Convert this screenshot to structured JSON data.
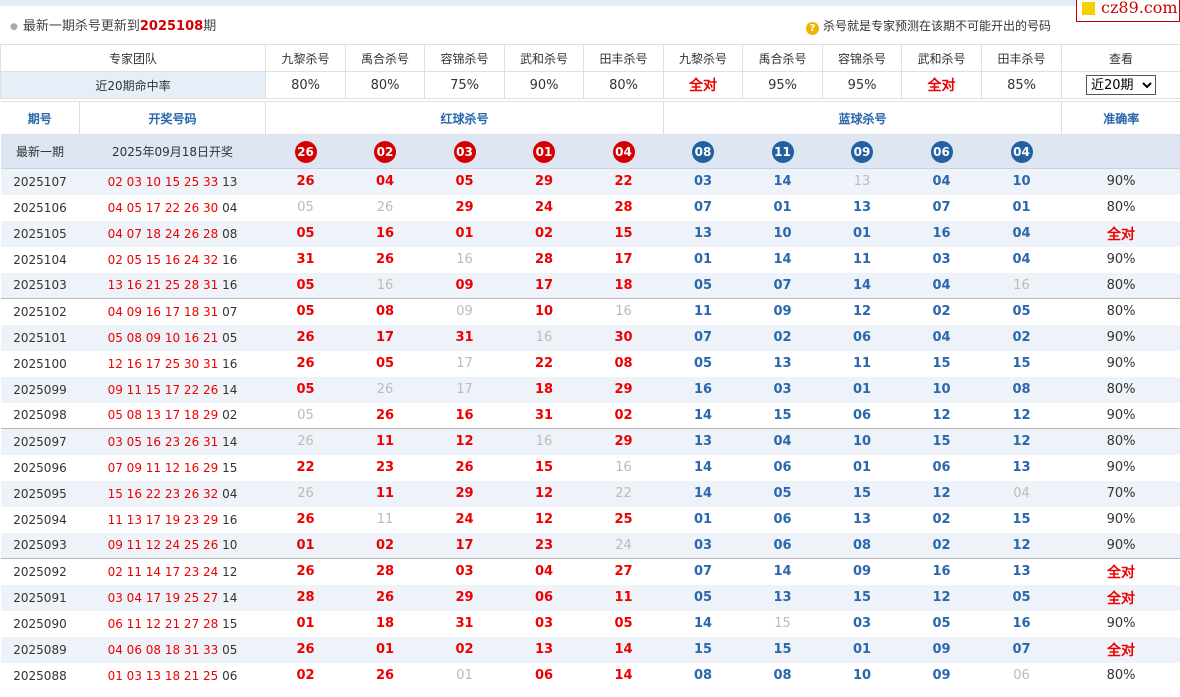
{
  "header": {
    "update_prefix": "最新一期杀号更新到",
    "latest_issue": "2025108",
    "update_suffix": "期",
    "tip_icon": "question-icon",
    "tip_text": "杀号就是专家预测在该期不可能开出的号码",
    "logo_text": "cz89.com"
  },
  "experts": {
    "team_label": "专家团队",
    "names": [
      "九黎杀号",
      "禹合杀号",
      "容锦杀号",
      "武和杀号",
      "田丰杀号",
      "九黎杀号",
      "禹合杀号",
      "容锦杀号",
      "武和杀号",
      "田丰杀号"
    ],
    "view_label": "查看",
    "rate_label": "近20期命中率",
    "rates": [
      "80%",
      "80%",
      "75%",
      "90%",
      "80%",
      "全对",
      "95%",
      "95%",
      "全对",
      "85%"
    ],
    "period_select": "近20期"
  },
  "columns": {
    "issue": "期号",
    "draw": "开奖号码",
    "red_kill": "红球杀号",
    "blue_kill": "蓝球杀号",
    "accuracy": "准确率"
  },
  "latest": {
    "label": "最新一期",
    "draw_date": "2025年09月18日开奖",
    "red": [
      "26",
      "02",
      "03",
      "01",
      "04"
    ],
    "blue": [
      "08",
      "11",
      "09",
      "06",
      "04"
    ]
  },
  "colors": {
    "red": "#d60000",
    "blue": "#23609f",
    "miss": "#bbbbbb",
    "header_blue": "#2a67ad"
  },
  "rows": [
    {
      "issue": "2025107",
      "red_nums": "02 03 10 15 25 33",
      "blue_num": "13",
      "red": [
        "26",
        "04",
        "05",
        "29",
        "22"
      ],
      "red_hit": [
        1,
        1,
        1,
        1,
        1
      ],
      "blue": [
        "03",
        "14",
        "13",
        "04",
        "10"
      ],
      "blue_hit": [
        1,
        1,
        0,
        1,
        1
      ],
      "acc": "90%"
    },
    {
      "issue": "2025106",
      "red_nums": "04 05 17 22 26 30",
      "blue_num": "04",
      "red": [
        "05",
        "26",
        "29",
        "24",
        "28"
      ],
      "red_hit": [
        0,
        0,
        1,
        1,
        1
      ],
      "blue": [
        "07",
        "01",
        "13",
        "07",
        "01"
      ],
      "blue_hit": [
        1,
        1,
        1,
        1,
        1
      ],
      "acc": "80%"
    },
    {
      "issue": "2025105",
      "red_nums": "04 07 18 24 26 28",
      "blue_num": "08",
      "red": [
        "05",
        "16",
        "01",
        "02",
        "15"
      ],
      "red_hit": [
        1,
        1,
        1,
        1,
        1
      ],
      "blue": [
        "13",
        "10",
        "01",
        "16",
        "04"
      ],
      "blue_hit": [
        1,
        1,
        1,
        1,
        1
      ],
      "acc": "全对"
    },
    {
      "issue": "2025104",
      "red_nums": "02 05 15 16 24 32",
      "blue_num": "16",
      "red": [
        "31",
        "26",
        "16",
        "28",
        "17"
      ],
      "red_hit": [
        1,
        1,
        0,
        1,
        1
      ],
      "blue": [
        "01",
        "14",
        "11",
        "03",
        "04"
      ],
      "blue_hit": [
        1,
        1,
        1,
        1,
        1
      ],
      "acc": "90%"
    },
    {
      "issue": "2025103",
      "red_nums": "13 16 21 25 28 31",
      "blue_num": "16",
      "red": [
        "05",
        "16",
        "09",
        "17",
        "18"
      ],
      "red_hit": [
        1,
        0,
        1,
        1,
        1
      ],
      "blue": [
        "05",
        "07",
        "14",
        "04",
        "16"
      ],
      "blue_hit": [
        1,
        1,
        1,
        1,
        0
      ],
      "acc": "80%"
    },
    {
      "issue": "2025102",
      "red_nums": "04 09 16 17 18 31",
      "blue_num": "07",
      "red": [
        "05",
        "08",
        "09",
        "10",
        "16"
      ],
      "red_hit": [
        1,
        1,
        0,
        1,
        0
      ],
      "blue": [
        "11",
        "09",
        "12",
        "02",
        "05"
      ],
      "blue_hit": [
        1,
        1,
        1,
        1,
        1
      ],
      "acc": "80%"
    },
    {
      "issue": "2025101",
      "red_nums": "05 08 09 10 16 21",
      "blue_num": "05",
      "red": [
        "26",
        "17",
        "31",
        "16",
        "30"
      ],
      "red_hit": [
        1,
        1,
        1,
        0,
        1
      ],
      "blue": [
        "07",
        "02",
        "06",
        "04",
        "02"
      ],
      "blue_hit": [
        1,
        1,
        1,
        1,
        1
      ],
      "acc": "90%"
    },
    {
      "issue": "2025100",
      "red_nums": "12 16 17 25 30 31",
      "blue_num": "16",
      "red": [
        "26",
        "05",
        "17",
        "22",
        "08"
      ],
      "red_hit": [
        1,
        1,
        0,
        1,
        1
      ],
      "blue": [
        "05",
        "13",
        "11",
        "15",
        "15"
      ],
      "blue_hit": [
        1,
        1,
        1,
        1,
        1
      ],
      "acc": "90%"
    },
    {
      "issue": "2025099",
      "red_nums": "09 11 15 17 22 26",
      "blue_num": "14",
      "red": [
        "05",
        "26",
        "17",
        "18",
        "29"
      ],
      "red_hit": [
        1,
        0,
        0,
        1,
        1
      ],
      "blue": [
        "16",
        "03",
        "01",
        "10",
        "08"
      ],
      "blue_hit": [
        1,
        1,
        1,
        1,
        1
      ],
      "acc": "80%"
    },
    {
      "issue": "2025098",
      "red_nums": "05 08 13 17 18 29",
      "blue_num": "02",
      "red": [
        "05",
        "26",
        "16",
        "31",
        "02"
      ],
      "red_hit": [
        0,
        1,
        1,
        1,
        1
      ],
      "blue": [
        "14",
        "15",
        "06",
        "12",
        "12"
      ],
      "blue_hit": [
        1,
        1,
        1,
        1,
        1
      ],
      "acc": "90%"
    },
    {
      "issue": "2025097",
      "red_nums": "03 05 16 23 26 31",
      "blue_num": "14",
      "red": [
        "26",
        "11",
        "12",
        "16",
        "29"
      ],
      "red_hit": [
        0,
        1,
        1,
        0,
        1
      ],
      "blue": [
        "13",
        "04",
        "10",
        "15",
        "12"
      ],
      "blue_hit": [
        1,
        1,
        1,
        1,
        1
      ],
      "acc": "80%"
    },
    {
      "issue": "2025096",
      "red_nums": "07 09 11 12 16 29",
      "blue_num": "15",
      "red": [
        "22",
        "23",
        "26",
        "15",
        "16"
      ],
      "red_hit": [
        1,
        1,
        1,
        1,
        0
      ],
      "blue": [
        "14",
        "06",
        "01",
        "06",
        "13"
      ],
      "blue_hit": [
        1,
        1,
        1,
        1,
        1
      ],
      "acc": "90%"
    },
    {
      "issue": "2025095",
      "red_nums": "15 16 22 23 26 32",
      "blue_num": "04",
      "red": [
        "26",
        "11",
        "29",
        "12",
        "22"
      ],
      "red_hit": [
        0,
        1,
        1,
        1,
        0
      ],
      "blue": [
        "14",
        "05",
        "15",
        "12",
        "04"
      ],
      "blue_hit": [
        1,
        1,
        1,
        1,
        0
      ],
      "acc": "70%"
    },
    {
      "issue": "2025094",
      "red_nums": "11 13 17 19 23 29",
      "blue_num": "16",
      "red": [
        "26",
        "11",
        "24",
        "12",
        "25"
      ],
      "red_hit": [
        1,
        0,
        1,
        1,
        1
      ],
      "blue": [
        "01",
        "06",
        "13",
        "02",
        "15"
      ],
      "blue_hit": [
        1,
        1,
        1,
        1,
        1
      ],
      "acc": "90%"
    },
    {
      "issue": "2025093",
      "red_nums": "09 11 12 24 25 26",
      "blue_num": "10",
      "red": [
        "01",
        "02",
        "17",
        "23",
        "24"
      ],
      "red_hit": [
        1,
        1,
        1,
        1,
        0
      ],
      "blue": [
        "03",
        "06",
        "08",
        "02",
        "12"
      ],
      "blue_hit": [
        1,
        1,
        1,
        1,
        1
      ],
      "acc": "90%"
    },
    {
      "issue": "2025092",
      "red_nums": "02 11 14 17 23 24",
      "blue_num": "12",
      "red": [
        "26",
        "28",
        "03",
        "04",
        "27"
      ],
      "red_hit": [
        1,
        1,
        1,
        1,
        1
      ],
      "blue": [
        "07",
        "14",
        "09",
        "16",
        "13"
      ],
      "blue_hit": [
        1,
        1,
        1,
        1,
        1
      ],
      "acc": "全对"
    },
    {
      "issue": "2025091",
      "red_nums": "03 04 17 19 25 27",
      "blue_num": "14",
      "red": [
        "28",
        "26",
        "29",
        "06",
        "11"
      ],
      "red_hit": [
        1,
        1,
        1,
        1,
        1
      ],
      "blue": [
        "05",
        "13",
        "15",
        "12",
        "05"
      ],
      "blue_hit": [
        1,
        1,
        1,
        1,
        1
      ],
      "acc": "全对"
    },
    {
      "issue": "2025090",
      "red_nums": "06 11 12 21 27 28",
      "blue_num": "15",
      "red": [
        "01",
        "18",
        "31",
        "03",
        "05"
      ],
      "red_hit": [
        1,
        1,
        1,
        1,
        1
      ],
      "blue": [
        "14",
        "15",
        "03",
        "05",
        "16"
      ],
      "blue_hit": [
        1,
        0,
        1,
        1,
        1
      ],
      "acc": "90%"
    },
    {
      "issue": "2025089",
      "red_nums": "04 06 08 18 31 33",
      "blue_num": "05",
      "red": [
        "26",
        "01",
        "02",
        "13",
        "14"
      ],
      "red_hit": [
        1,
        1,
        1,
        1,
        1
      ],
      "blue": [
        "15",
        "15",
        "01",
        "09",
        "07"
      ],
      "blue_hit": [
        1,
        1,
        1,
        1,
        1
      ],
      "acc": "全对"
    },
    {
      "issue": "2025088",
      "red_nums": "01 03 13 18 21 25",
      "blue_num": "06",
      "red": [
        "02",
        "26",
        "01",
        "06",
        "14"
      ],
      "red_hit": [
        1,
        1,
        0,
        1,
        1
      ],
      "blue": [
        "08",
        "08",
        "10",
        "09",
        "06"
      ],
      "blue_hit": [
        1,
        1,
        1,
        1,
        0
      ],
      "acc": "80%"
    }
  ]
}
